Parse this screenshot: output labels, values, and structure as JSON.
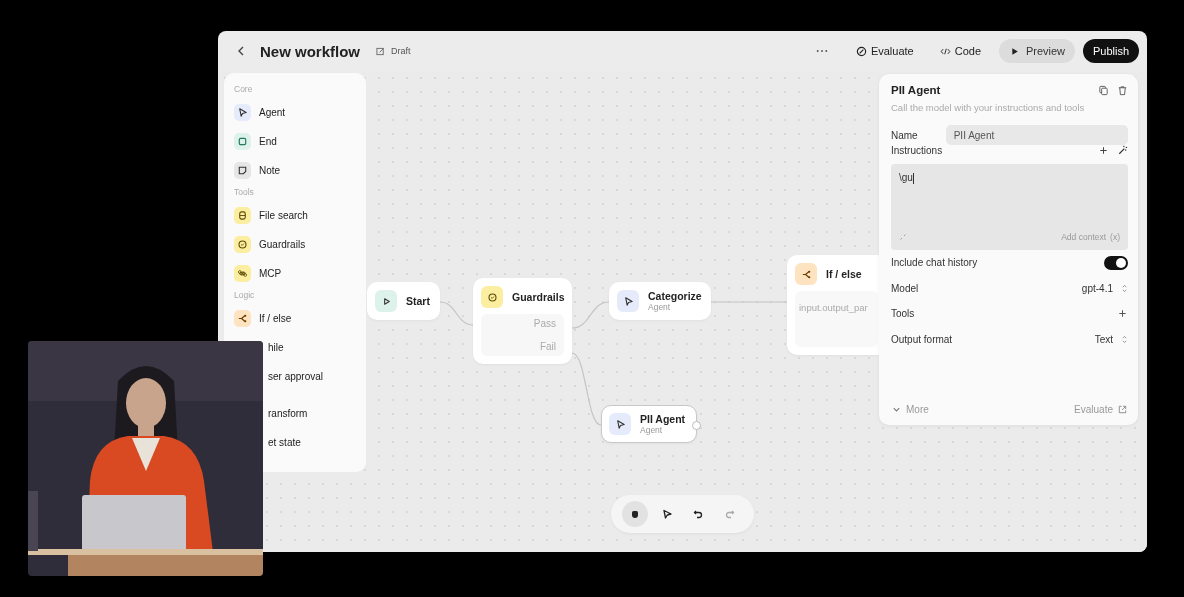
{
  "header": {
    "title": "New workflow",
    "status": "Draft",
    "actions": [
      {
        "label": "Evaluate",
        "kind": "evaluate"
      },
      {
        "label": "Code",
        "kind": "code"
      }
    ],
    "preview": "Preview",
    "publish": "Publish"
  },
  "sidebar": {
    "sections": [
      {
        "label": "Core",
        "items": [
          {
            "label": "Agent",
            "kind": "agent"
          },
          {
            "label": "End",
            "kind": "end"
          },
          {
            "label": "Note",
            "kind": "note"
          }
        ]
      },
      {
        "label": "Tools",
        "items": [
          {
            "label": "File search",
            "kind": "file-search"
          },
          {
            "label": "Guardrails",
            "kind": "guardrails"
          },
          {
            "label": "MCP",
            "kind": "mcp"
          }
        ]
      },
      {
        "label": "Logic",
        "items": [
          {
            "label": "If / else",
            "kind": "if-else"
          },
          {
            "label": "hile",
            "kind": "covered"
          },
          {
            "label": "ser approval",
            "kind": "covered"
          }
        ]
      },
      {
        "items": [
          {
            "label": "ransform",
            "kind": "covered"
          },
          {
            "label": "et state",
            "kind": "covered"
          }
        ]
      }
    ]
  },
  "canvas": {
    "nodes": [
      {
        "kind": "start",
        "title": "Start",
        "selected": false
      },
      {
        "kind": "guardrails",
        "title": "Guardrails",
        "outputs": [
          "Pass",
          "Fail"
        ],
        "selected": false
      },
      {
        "kind": "agent",
        "title": "Categorize",
        "subtitle": "Agent",
        "selected": false
      },
      {
        "kind": "if-else",
        "title": "If / else",
        "condition": "input.output_par",
        "selected": false
      },
      {
        "kind": "agent",
        "title": "PII Agent",
        "subtitle": "Agent",
        "selected": true
      }
    ],
    "toolbar": [
      {
        "kind": "hand",
        "selected": true,
        "disabled": false
      },
      {
        "kind": "pointer",
        "selected": false,
        "disabled": false
      },
      {
        "kind": "undo",
        "selected": false,
        "disabled": false
      },
      {
        "kind": "redo",
        "selected": false,
        "disabled": true
      }
    ]
  },
  "panel": {
    "title": "PII Agent",
    "description": "Call the model with your instructions and tools",
    "name_label": "Name",
    "name_value": "PII Agent",
    "instructions_label": "Instructions",
    "instructions_value": "\\gu",
    "add_context": "Add context",
    "context_token": "(x)",
    "settings": [
      {
        "kind": "toggle",
        "label": "Include chat history",
        "on": true
      },
      {
        "kind": "select",
        "label": "Model",
        "value": "gpt-4.1"
      },
      {
        "kind": "add",
        "label": "Tools"
      },
      {
        "kind": "select",
        "label": "Output format",
        "value": "Text"
      }
    ],
    "more": "More",
    "evaluate": "Evaluate"
  }
}
